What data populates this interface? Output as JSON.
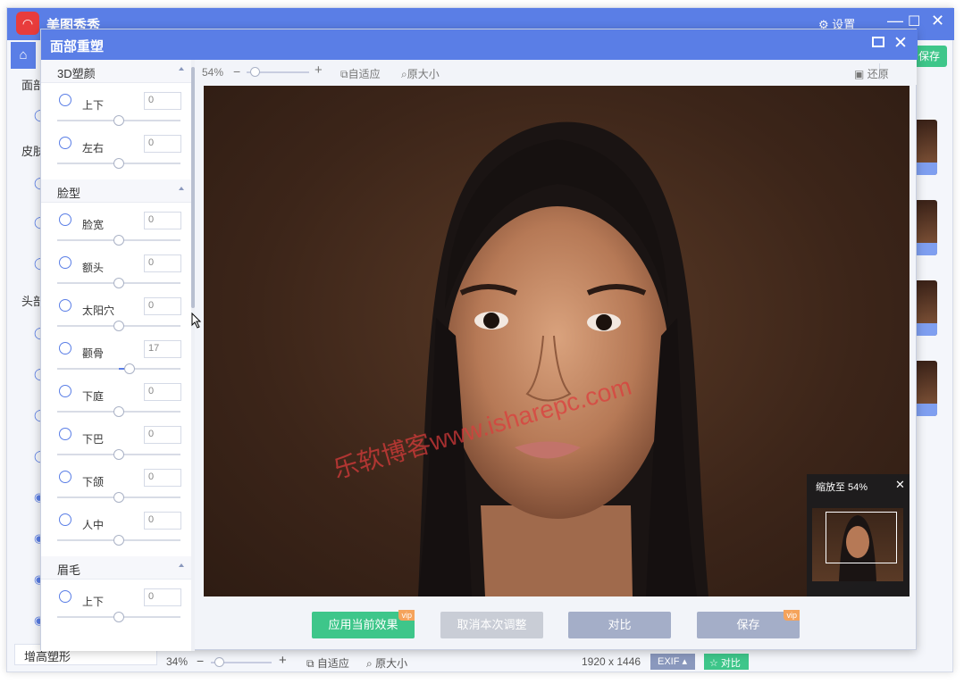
{
  "app": {
    "title": "美图秀秀",
    "settings_label": "设置",
    "save_label": "保存"
  },
  "bg_left": {
    "labels": [
      "面部",
      "皮肤",
      "头部"
    ],
    "bottom_label": "增高塑形"
  },
  "bg_status": {
    "zoom": "34%",
    "fit": "自适应",
    "original": "原大小",
    "dimensions": "1920 x 1446",
    "exif": "EXIF",
    "compare": "对比"
  },
  "dialog": {
    "title": "面部重塑"
  },
  "toolbar": {
    "zoom": "54%",
    "fit": "自适应",
    "original": "原大小",
    "restore": "还原"
  },
  "sections": [
    {
      "title": "3D塑颜",
      "items": [
        {
          "label": "上下",
          "value": "0",
          "level": 0.5
        },
        {
          "label": "左右",
          "value": "0",
          "level": 0.5
        }
      ]
    },
    {
      "title": "脸型",
      "items": [
        {
          "label": "脸宽",
          "value": "0",
          "level": 0.5
        },
        {
          "label": "额头",
          "value": "0",
          "level": 0.5
        },
        {
          "label": "太阳穴",
          "value": "0",
          "level": 0.5
        },
        {
          "label": "颧骨",
          "value": "17",
          "level": 0.585
        },
        {
          "label": "下庭",
          "value": "0",
          "level": 0.5
        },
        {
          "label": "下巴",
          "value": "0",
          "level": 0.5
        },
        {
          "label": "下颌",
          "value": "0",
          "level": 0.5
        },
        {
          "label": "人中",
          "value": "0",
          "level": 0.5
        }
      ]
    },
    {
      "title": "眉毛",
      "items": [
        {
          "label": "上下",
          "value": "0",
          "level": 0.5
        }
      ]
    }
  ],
  "watermark": "乐软博客www.isharepc.com",
  "navigator": {
    "zoom_label": "缩放至 54%"
  },
  "buttons": {
    "apply": "应用当前效果",
    "cancel": "取消本次调整",
    "compare": "对比",
    "save": "保存",
    "vip": "vip"
  },
  "colors": {
    "accent": "#5a7ee6",
    "apply_green": "#3ec68a",
    "secondary": "#a4aec8",
    "vip_orange": "#f5a35b"
  }
}
